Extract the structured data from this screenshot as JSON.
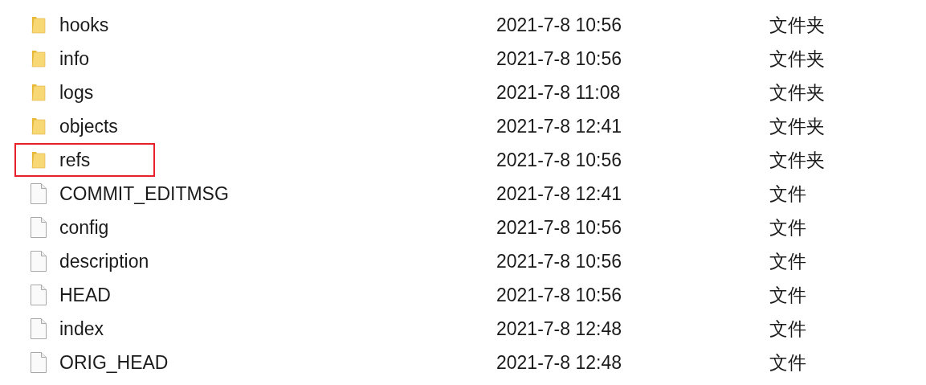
{
  "files": [
    {
      "kind": "folder",
      "name": "hooks",
      "modified": "2021-7-8 10:56",
      "type": "文件夹",
      "highlighted": false
    },
    {
      "kind": "folder",
      "name": "info",
      "modified": "2021-7-8 10:56",
      "type": "文件夹",
      "highlighted": false
    },
    {
      "kind": "folder",
      "name": "logs",
      "modified": "2021-7-8 11:08",
      "type": "文件夹",
      "highlighted": false
    },
    {
      "kind": "folder",
      "name": "objects",
      "modified": "2021-7-8 12:41",
      "type": "文件夹",
      "highlighted": false
    },
    {
      "kind": "folder",
      "name": "refs",
      "modified": "2021-7-8 10:56",
      "type": "文件夹",
      "highlighted": true
    },
    {
      "kind": "file",
      "name": "COMMIT_EDITMSG",
      "modified": "2021-7-8 12:41",
      "type": "文件",
      "highlighted": false
    },
    {
      "kind": "file",
      "name": "config",
      "modified": "2021-7-8 10:56",
      "type": "文件",
      "highlighted": false
    },
    {
      "kind": "file",
      "name": "description",
      "modified": "2021-7-8 10:56",
      "type": "文件",
      "highlighted": false
    },
    {
      "kind": "file",
      "name": "HEAD",
      "modified": "2021-7-8 10:56",
      "type": "文件",
      "highlighted": false
    },
    {
      "kind": "file",
      "name": "index",
      "modified": "2021-7-8 12:48",
      "type": "文件",
      "highlighted": false
    },
    {
      "kind": "file",
      "name": "ORIG_HEAD",
      "modified": "2021-7-8 12:48",
      "type": "文件",
      "highlighted": false
    }
  ]
}
